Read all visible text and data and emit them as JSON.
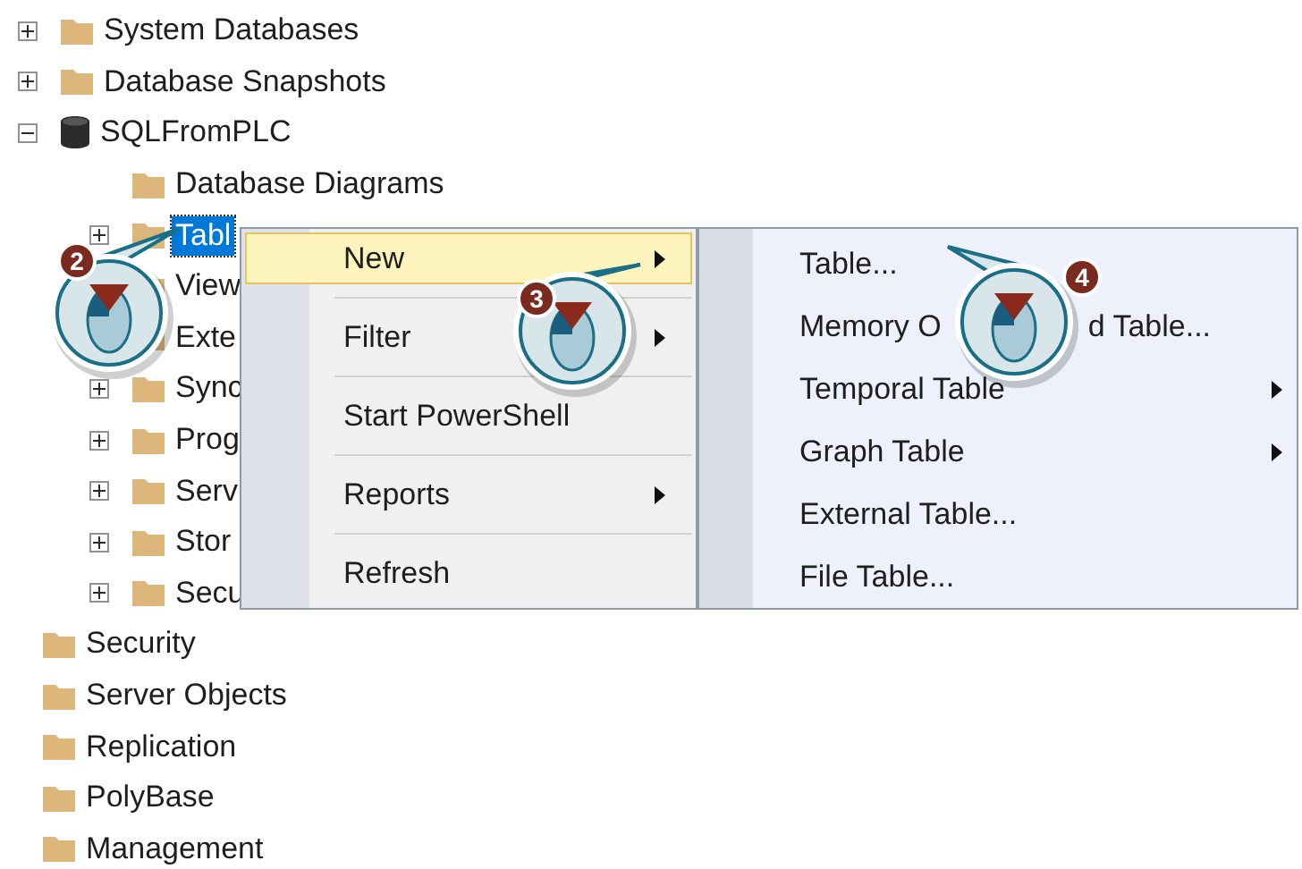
{
  "tree": {
    "database_nodes": [
      {
        "label": "System Databases",
        "kind": "folder",
        "expanded": false,
        "selected": false
      },
      {
        "label": "Database Snapshots",
        "kind": "folder",
        "expanded": false,
        "selected": false
      },
      {
        "label": "SQLFromPLC",
        "kind": "database",
        "expanded": true,
        "selected": false,
        "children": [
          {
            "label": "Database Diagrams",
            "selected": false
          },
          {
            "label": "Tabl",
            "expanded": false,
            "selected": true
          },
          {
            "label": "View",
            "selected": false
          },
          {
            "label": "Exte",
            "selected": false
          },
          {
            "label": "Sync",
            "expanded": false,
            "selected": false
          },
          {
            "label": "Prog",
            "expanded": false,
            "selected": false
          },
          {
            "label": "Serv",
            "expanded": false,
            "selected": false
          },
          {
            "label": "Stor",
            "expanded": false,
            "selected": false
          },
          {
            "label": "Secu",
            "expanded": false,
            "selected": false
          }
        ]
      }
    ],
    "server_nodes": [
      {
        "label": "Security",
        "selected": false
      },
      {
        "label": "Server Objects",
        "selected": false
      },
      {
        "label": "Replication",
        "selected": false
      },
      {
        "label": "PolyBase",
        "selected": false
      },
      {
        "label": "Management",
        "selected": false
      }
    ]
  },
  "context_menu": [
    {
      "label": "New",
      "submenu": true,
      "selected": true
    },
    {
      "label": "Filter",
      "submenu": true,
      "selected": false
    },
    {
      "label": "Start PowerShell",
      "submenu": false,
      "selected": false
    },
    {
      "label": "Reports",
      "submenu": true,
      "selected": false
    },
    {
      "label": "Refresh",
      "submenu": false,
      "selected": false
    }
  ],
  "submenu": [
    {
      "label": "Table...",
      "submenu": false
    },
    {
      "label": "Memory O",
      "label_tail": "d Table...",
      "submenu": false
    },
    {
      "label": "Temporal Table",
      "submenu": true
    },
    {
      "label": "Graph Table",
      "submenu": true
    },
    {
      "label": "External Table...",
      "submenu": false
    },
    {
      "label": "File Table...",
      "submenu": false
    }
  ],
  "callouts": [
    {
      "step": "2"
    },
    {
      "step": "3"
    },
    {
      "step": "4"
    }
  ]
}
